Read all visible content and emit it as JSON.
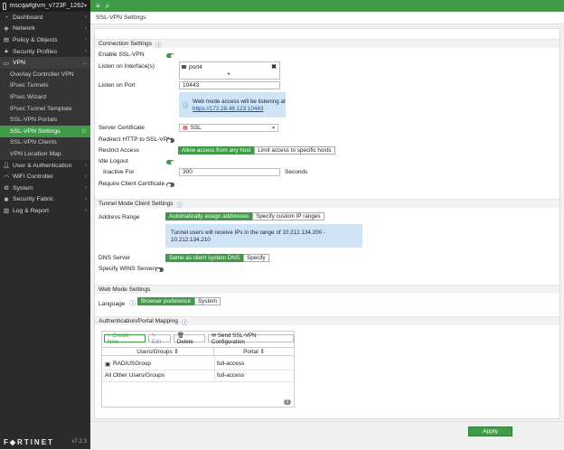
{
  "device": {
    "name": "mscqa#gtvm_v723F_1262"
  },
  "nav": {
    "items": [
      {
        "label": "Dashboard",
        "icon": "dashboard-icon",
        "type": "item"
      },
      {
        "label": "Network",
        "icon": "network-icon",
        "type": "item"
      },
      {
        "label": "Policy & Objects",
        "icon": "policy-icon",
        "type": "item"
      },
      {
        "label": "Security Profiles",
        "icon": "lock-icon",
        "type": "item"
      },
      {
        "label": "VPN",
        "icon": "monitor-icon",
        "type": "section"
      },
      {
        "label": "Overlay Controller VPN",
        "type": "sub"
      },
      {
        "label": "IPsec Tunnels",
        "type": "sub"
      },
      {
        "label": "IPsec Wizard",
        "type": "sub"
      },
      {
        "label": "IPsec Tunnel Template",
        "type": "sub"
      },
      {
        "label": "SSL-VPN Portals",
        "type": "sub"
      },
      {
        "label": "SSL-VPN Settings",
        "type": "active"
      },
      {
        "label": "SSL-VPN Clients",
        "type": "sub"
      },
      {
        "label": "VPN Location Map",
        "type": "sub"
      },
      {
        "label": "User & Authentication",
        "icon": "user-icon",
        "type": "item"
      },
      {
        "label": "WiFi Controller",
        "icon": "wifi-icon",
        "type": "item"
      },
      {
        "label": "System",
        "icon": "gear-icon",
        "type": "item"
      },
      {
        "label": "Security Fabric",
        "icon": "fabric-icon",
        "type": "item"
      },
      {
        "label": "Log & Report",
        "icon": "chart-icon",
        "type": "item"
      }
    ],
    "logo": "F◆RTINET",
    "version": "v7.2.3"
  },
  "page": {
    "title": "SSL-VPN Settings"
  },
  "connection": {
    "heading": "Connection Settings",
    "enable_label": "Enable SSL-VPN",
    "listen_iface_label": "Listen on Interface(s)",
    "iface_chip": "port4",
    "listen_port_label": "Listen on Port",
    "listen_port_value": "10443",
    "note_text": "Web mode access will be listening at",
    "note_link": "https://172.28.48.123:10443",
    "cert_label": "Server Certificate",
    "cert_value": "SSL",
    "redirect_label": "Redirect HTTP to SSL-VPN",
    "restrict_label": "Restrict Access",
    "restrict_opt1": "Allow access from any host",
    "restrict_opt2": "Limit access to specific hosts",
    "idle_label": "Idle Logout",
    "inactive_label": "Inactive For",
    "inactive_value": "300",
    "inactive_unit": "Seconds",
    "require_cert_label": "Require Client Certificate"
  },
  "tunnel": {
    "heading": "Tunnel Mode Client Settings",
    "address_label": "Address Range",
    "addr_opt1": "Automatically assign addresses",
    "addr_opt2": "Specify custom IP ranges",
    "note_line1": "Tunnel users will receive IPs in the range of 10.212.134.200 -",
    "note_line2": "10.212.134.210",
    "dns_label": "DNS Server",
    "dns_opt1": "Same as client system DNS",
    "dns_opt2": "Specify",
    "wins_label": "Specify WINS Servers"
  },
  "webmode": {
    "heading": "Web Mode Settings",
    "language_label": "Language",
    "lang_opt1": "Browser preference",
    "lang_opt2": "System"
  },
  "auth": {
    "heading": "Authentication/Portal Mapping",
    "btn_create": "+ Create New",
    "btn_edit": "✎ Edit",
    "btn_delete": "🗑 Delete",
    "btn_send": "✉ Send SSL-VPN Configuration",
    "col_users": "Users/Groups ⇕",
    "col_portal": "Portal ⇕",
    "rows": [
      {
        "user": "RADIUSGroup",
        "portal": "full-access"
      },
      {
        "user": "All Other Users/Groups",
        "portal": "full-access"
      }
    ],
    "count": "2"
  },
  "footer": {
    "apply": "Apply"
  }
}
